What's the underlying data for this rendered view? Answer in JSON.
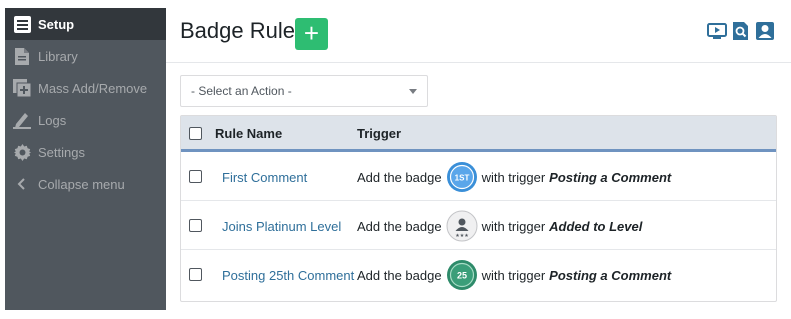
{
  "sidebar": {
    "items": [
      {
        "label": "Setup",
        "icon": "list-icon"
      },
      {
        "label": "Library",
        "icon": "document-icon"
      },
      {
        "label": "Mass Add/Remove",
        "icon": "plus-box-icon"
      },
      {
        "label": "Logs",
        "icon": "pencil-icon"
      },
      {
        "label": "Settings",
        "icon": "gear-icon"
      },
      {
        "label": "Collapse menu",
        "icon": "chevron-left-icon"
      }
    ]
  },
  "header": {
    "title": "Badge Rules",
    "add_label": "+"
  },
  "action_select": {
    "value": "- Select an Action -"
  },
  "table": {
    "columns": [
      "Rule Name",
      "Trigger"
    ],
    "rows": [
      {
        "rule_name": "First Comment",
        "prefix": "Add the badge",
        "badge_text": "1ST",
        "mid": "with trigger",
        "trigger": "Posting a Comment"
      },
      {
        "rule_name": "Joins Platinum Level",
        "prefix": "Add the badge",
        "badge_text": "",
        "mid": "with trigger",
        "trigger": "Added to Level"
      },
      {
        "rule_name": "Posting 25th Comment",
        "prefix": "Add the badge",
        "badge_text": "25",
        "mid": "with trigger",
        "trigger": "Posting a Comment"
      }
    ]
  },
  "colors": {
    "sidebar_bg": "#50575e",
    "sidebar_active_bg": "#32373c",
    "add_button": "#2ebd72",
    "link": "#2f6f9a",
    "header_icons": "#2f6f9a",
    "badge_blue": "#3a8fd8",
    "badge_green": "#2e8b6a"
  }
}
